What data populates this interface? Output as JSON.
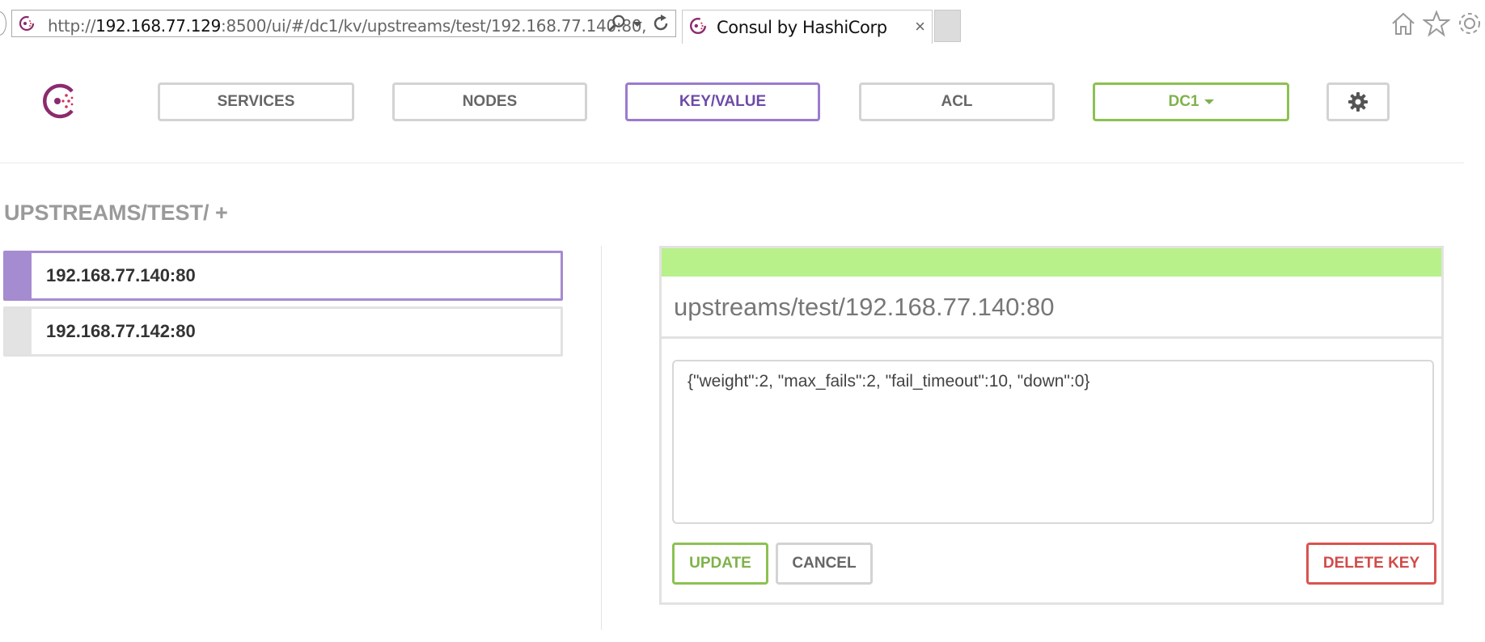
{
  "browser": {
    "url_prefix": "http://",
    "url_host": "192.168.77.129",
    "url_rest": ":8500/ui/#/dc1/kv/upstreams/test/192.168.77.140:80,",
    "tab_title": "Consul by HashiCorp",
    "tab_close": "×"
  },
  "nav": {
    "services": "SERVICES",
    "nodes": "NODES",
    "keyvalue": "KEY/VALUE",
    "acl": "ACL",
    "datacenter": "DC1"
  },
  "kv": {
    "breadcrumb": "UPSTREAMS/TEST/ +",
    "keys": [
      {
        "label": "192.168.77.140:80",
        "active": true
      },
      {
        "label": "192.168.77.142:80",
        "active": false
      }
    ],
    "selected_key": "upstreams/test/192.168.77.140:80",
    "value": "{\"weight\":2, \"max_fails\":2, \"fail_timeout\":10, \"down\":0}",
    "update_label": "UPDATE",
    "cancel_label": "CANCEL",
    "delete_label": "DELETE KEY"
  },
  "colors": {
    "accent_purple": "#9b7bcd",
    "accent_green": "#8cc152",
    "danger_red": "#d9534f",
    "panel_header": "#b8f08a"
  },
  "icons": [
    "search-icon",
    "dropdown-icon",
    "refresh-icon",
    "home-icon",
    "star-icon",
    "gear-icon",
    "consul-logo"
  ]
}
